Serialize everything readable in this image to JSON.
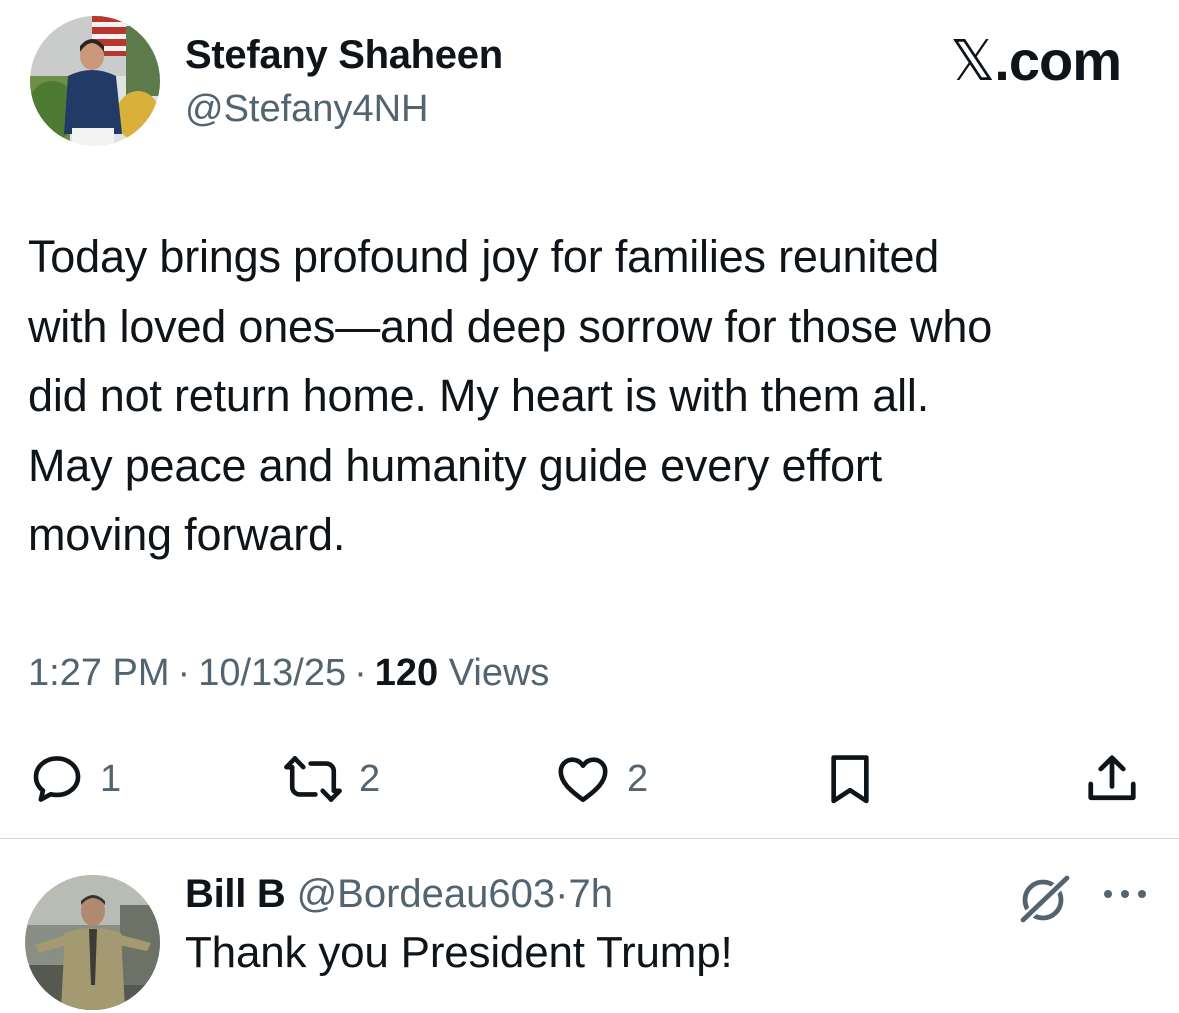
{
  "author": {
    "name": "Stefany Shaheen",
    "handle": "@Stefany4NH",
    "avatar_icon": "profile-photo"
  },
  "site_label": {
    "glyph": "𝕏",
    "text": ".com"
  },
  "tweet": {
    "lines": [
      "Today brings profound joy for families reunited",
      "with loved ones—and deep sorrow for those who",
      "did not return home. My heart is with them all.",
      "May peace and humanity guide every effort",
      "moving forward."
    ],
    "time": "1:27 PM",
    "date": "10/13/25",
    "separator": "·",
    "views_count": "120",
    "views_label": "Views"
  },
  "actions": {
    "reply": {
      "icon": "reply-bubble-icon",
      "count": "1"
    },
    "retweet": {
      "icon": "retweet-icon",
      "count": "2"
    },
    "like": {
      "icon": "heart-icon",
      "count": "2"
    },
    "bookmark": {
      "icon": "bookmark-icon"
    },
    "share": {
      "icon": "share-icon"
    }
  },
  "reply": {
    "name": "Bill B",
    "handle": "@Bordeau603",
    "separator": "·",
    "time": "7h",
    "text": "Thank you President Trump!"
  },
  "colors": {
    "text_primary": "#0f1419",
    "text_secondary": "#536471",
    "divider": "#cfd9de"
  }
}
